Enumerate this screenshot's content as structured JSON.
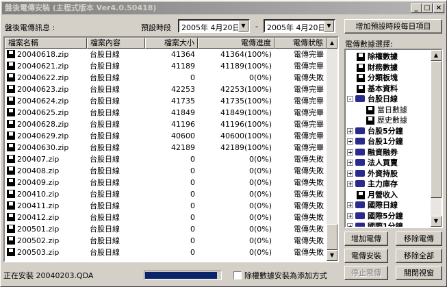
{
  "window": {
    "title": "盤後電傳安裝 (主程式版本 Ver4.0.50418)"
  },
  "header": {
    "info_label": "盤後電傳訊息 :",
    "period_label": "預設時段",
    "date_from": "2005年  4月20日",
    "date_sep": "-",
    "date_to": "2005年  4月20日",
    "add_schedule_button": "增加預設時段每日項目"
  },
  "table": {
    "columns": [
      "檔案名稱",
      "檔案內容",
      "檔案大小",
      "電傳進度",
      "電傳狀態"
    ],
    "rows": [
      {
        "name": "20040618.zip",
        "content": "台股日線",
        "size": "41364",
        "progress": "41364(100%)",
        "status": "電傳完畢"
      },
      {
        "name": "20040621.zip",
        "content": "台股日線",
        "size": "41189",
        "progress": "41189(100%)",
        "status": "電傳完畢"
      },
      {
        "name": "20040622.zip",
        "content": "台股日線",
        "size": "0",
        "progress": "0(0%)",
        "status": "電傳失敗"
      },
      {
        "name": "20040623.zip",
        "content": "台股日線",
        "size": "42253",
        "progress": "42253(100%)",
        "status": "電傳完畢"
      },
      {
        "name": "20040624.zip",
        "content": "台股日線",
        "size": "41735",
        "progress": "41735(100%)",
        "status": "電傳完畢"
      },
      {
        "name": "20040625.zip",
        "content": "台股日線",
        "size": "41849",
        "progress": "41849(100%)",
        "status": "電傳完畢"
      },
      {
        "name": "20040628.zip",
        "content": "台股日線",
        "size": "41196",
        "progress": "41196(100%)",
        "status": "電傳完畢"
      },
      {
        "name": "20040629.zip",
        "content": "台股日線",
        "size": "40600",
        "progress": "40600(100%)",
        "status": "電傳完畢"
      },
      {
        "name": "20040630.zip",
        "content": "台股日線",
        "size": "42189",
        "progress": "42189(100%)",
        "status": "電傳完畢"
      },
      {
        "name": "200407.zip",
        "content": "台股日線",
        "size": "0",
        "progress": "0(0%)",
        "status": "電傳失敗"
      },
      {
        "name": "200408.zip",
        "content": "台股日線",
        "size": "0",
        "progress": "0(0%)",
        "status": "電傳失敗"
      },
      {
        "name": "200409.zip",
        "content": "台股日線",
        "size": "0",
        "progress": "0(0%)",
        "status": "電傳失敗"
      },
      {
        "name": "200410.zip",
        "content": "台股日線",
        "size": "0",
        "progress": "0(0%)",
        "status": "電傳失敗"
      },
      {
        "name": "200411.zip",
        "content": "台股日線",
        "size": "0",
        "progress": "0(0%)",
        "status": "電傳失敗"
      },
      {
        "name": "200412.zip",
        "content": "台股日線",
        "size": "0",
        "progress": "0(0%)",
        "status": "電傳失敗"
      },
      {
        "name": "200501.zip",
        "content": "台股日線",
        "size": "0",
        "progress": "0(0%)",
        "status": "電傳失敗"
      },
      {
        "name": "200502.zip",
        "content": "台股日線",
        "size": "0",
        "progress": "0(0%)",
        "status": "電傳失敗"
      },
      {
        "name": "200503.zip",
        "content": "台股日線",
        "size": "0",
        "progress": "0(0%)",
        "status": "電傳失敗"
      }
    ]
  },
  "tree": {
    "label": "電傳數據選擇:",
    "items": [
      {
        "label": "除權數據",
        "level": 0,
        "expander": "",
        "icon": "disk-icon"
      },
      {
        "label": "財務數據",
        "level": 0,
        "expander": "",
        "icon": "disk-icon"
      },
      {
        "label": "分類板塊",
        "level": 0,
        "expander": "",
        "icon": "disk-icon"
      },
      {
        "label": "基本資料",
        "level": 0,
        "expander": "",
        "icon": "disk-icon"
      },
      {
        "label": "台股日線",
        "level": 0,
        "expander": "-",
        "icon": "book-icon"
      },
      {
        "label": "當日數據",
        "level": 1,
        "expander": "",
        "icon": "disk-icon"
      },
      {
        "label": "歷史數據",
        "level": 1,
        "expander": "",
        "icon": "disk-icon"
      },
      {
        "label": "台股5分鐘",
        "level": 0,
        "expander": "+",
        "icon": "book-icon"
      },
      {
        "label": "台股1分鐘",
        "level": 0,
        "expander": "+",
        "icon": "book-icon"
      },
      {
        "label": "融資融券",
        "level": 0,
        "expander": "+",
        "icon": "book-icon"
      },
      {
        "label": "法人買賣",
        "level": 0,
        "expander": "+",
        "icon": "book-icon"
      },
      {
        "label": "外資持股",
        "level": 0,
        "expander": "+",
        "icon": "book-icon"
      },
      {
        "label": "主力庫存",
        "level": 0,
        "expander": "+",
        "icon": "book-icon"
      },
      {
        "label": "月營收入",
        "level": 0,
        "expander": "",
        "icon": "disk-icon"
      },
      {
        "label": "國際日線",
        "level": 0,
        "expander": "+",
        "icon": "book-icon"
      },
      {
        "label": "國際5分鐘",
        "level": 0,
        "expander": "+",
        "icon": "book-icon"
      },
      {
        "label": "國際1分鐘",
        "level": 0,
        "expander": "+",
        "icon": "book-icon"
      }
    ]
  },
  "buttons": {
    "add_transfer": "增加電傳",
    "remove_transfer": "移除電傳",
    "install": "電傳安裝",
    "remove_all": "移除全部",
    "stop": "停止電傳",
    "close": "關閉視窗"
  },
  "status": {
    "text": "正在安裝 20040203.QDA",
    "progress": 0.95,
    "checkbox_label": "除權數據安裝為添加方式"
  }
}
